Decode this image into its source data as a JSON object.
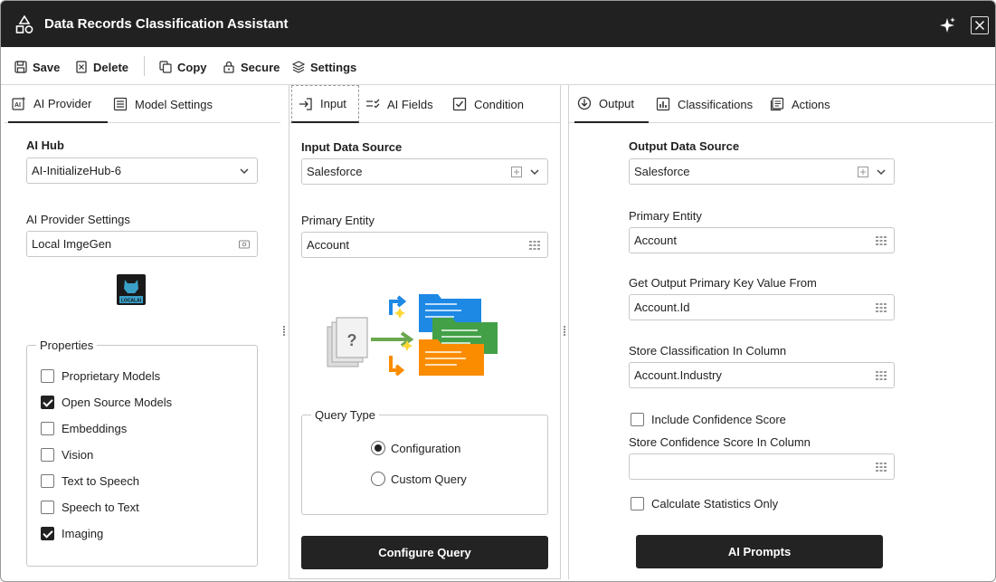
{
  "window": {
    "title": "Data Records Classification Assistant"
  },
  "toolbar": {
    "save_label": "Save",
    "delete_label": "Delete",
    "copy_label": "Copy",
    "secure_label": "Secure",
    "settings_label": "Settings"
  },
  "left_panel": {
    "tabs": [
      {
        "label": "AI Provider",
        "icon": "ai-provider-icon",
        "active": true
      },
      {
        "label": "Model Settings",
        "icon": "list-icon",
        "active": false
      }
    ],
    "ai_hub_label": "AI Hub",
    "ai_hub_value": "AI-InitializeHub-6",
    "provider_settings_label": "AI Provider Settings",
    "provider_settings_value": "Local ImgeGen",
    "logo_text": "LOCALAI",
    "properties_legend": "Properties",
    "properties": [
      {
        "label": "Proprietary Models",
        "checked": false
      },
      {
        "label": "Open Source Models",
        "checked": true
      },
      {
        "label": "Embeddings",
        "checked": false
      },
      {
        "label": "Vision",
        "checked": false
      },
      {
        "label": "Text to Speech",
        "checked": false
      },
      {
        "label": "Speech to Text",
        "checked": false
      },
      {
        "label": "Imaging",
        "checked": true
      }
    ]
  },
  "mid_panel": {
    "tabs": [
      {
        "label": "Input",
        "icon": "input-icon",
        "active": true
      },
      {
        "label": "AI Fields",
        "icon": "checklist-icon",
        "active": false
      },
      {
        "label": "Condition",
        "icon": "checkbox-icon",
        "active": false
      }
    ],
    "input_source_label": "Input Data Source",
    "input_source_value": "Salesforce",
    "primary_entity_label": "Primary Entity",
    "primary_entity_value": "Account",
    "illustration_mark": "?",
    "query_type_legend": "Query Type",
    "query_options": [
      {
        "label": "Configuration",
        "selected": true
      },
      {
        "label": "Custom Query",
        "selected": false
      }
    ],
    "configure_button": "Configure Query"
  },
  "right_panel": {
    "tabs": [
      {
        "label": "Output",
        "icon": "output-icon",
        "active": true
      },
      {
        "label": "Classifications",
        "icon": "bar-chart-icon",
        "active": false
      },
      {
        "label": "Actions",
        "icon": "actions-icon",
        "active": false
      }
    ],
    "output_source_label": "Output Data Source",
    "output_source_value": "Salesforce",
    "primary_entity_label": "Primary Entity",
    "primary_entity_value": "Account",
    "output_pk_label": "Get Output Primary Key Value From",
    "output_pk_value": "Account.Id",
    "store_column_label": "Store Classification In Column",
    "store_column_value": "Account.Industry",
    "include_confidence_label": "Include Confidence Score",
    "include_confidence_checked": false,
    "confidence_column_label": "Store Confidence Score In Column",
    "confidence_column_value": "",
    "stats_only_label": "Calculate Statistics Only",
    "stats_only_checked": false,
    "ai_prompts_button": "AI Prompts"
  },
  "colors": {
    "titlebar": "#212121",
    "dark_button": "#232323",
    "accent_blue": "#1e88e5",
    "accent_green": "#43a047",
    "accent_orange": "#fb8c00",
    "spark_yellow": "#fdd835"
  }
}
